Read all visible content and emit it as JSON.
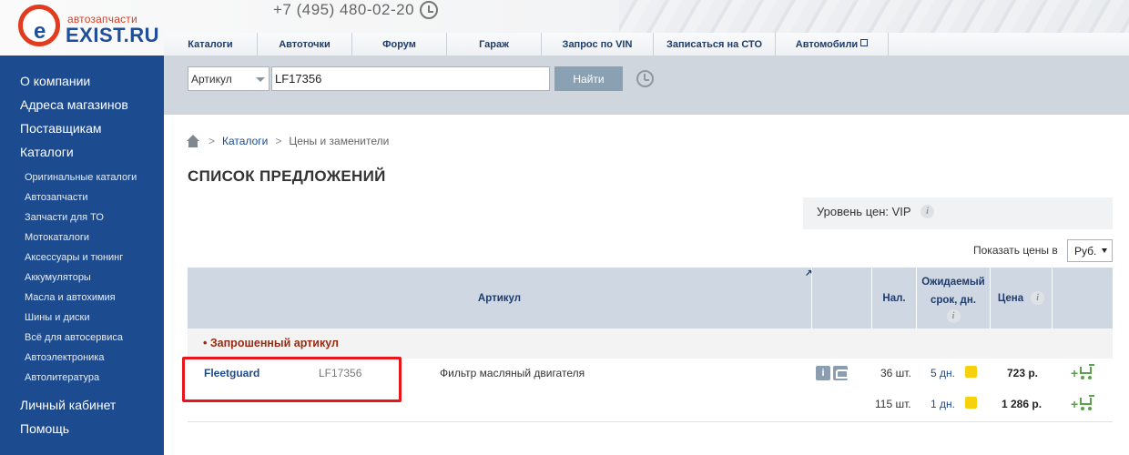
{
  "header": {
    "logo_small": "автозапчасти",
    "logo_big": "EXIST.RU",
    "logo_letter": "e",
    "phone": "+7 (495) 480-02-20",
    "nav": [
      {
        "label": "Каталоги"
      },
      {
        "label": "Автоточки"
      },
      {
        "label": "Форум"
      },
      {
        "label": "Гараж"
      },
      {
        "label": "Запрос по VIN"
      },
      {
        "label": "Записаться на СТО"
      },
      {
        "label": "Автомобили"
      }
    ]
  },
  "sidebar": {
    "main_top": [
      "О компании",
      "Адреса магазинов",
      "Поставщикам",
      "Каталоги"
    ],
    "sub": [
      "Оригинальные каталоги",
      "Автозапчасти",
      "Запчасти для ТО",
      "Мотокаталоги",
      "Аксессуары и тюнинг",
      "Аккумуляторы",
      "Масла и автохимия",
      "Шины и диски",
      "Всё для автосервиса",
      "Автоэлектроника",
      "Автолитература"
    ],
    "main_bottom": [
      "Личный кабинет",
      "Помощь"
    ]
  },
  "search": {
    "type": "Артикул",
    "value": "LF17356",
    "button": "Найти"
  },
  "breadcrumb": {
    "link": "Каталоги",
    "current": "Цены и заменители",
    "sep": ">"
  },
  "page_title": "СПИСОК ПРЕДЛОЖЕНИЙ",
  "price_level": {
    "text": "Уровень цен: VIP",
    "info": "i"
  },
  "show_prices": {
    "label": "Показать цены в",
    "currency": "Руб."
  },
  "table": {
    "headers": {
      "article": "Артикул",
      "stock": "Нал.",
      "delivery_line1": "Ожидаемый",
      "delivery_line2": "срок, дн.",
      "price": "Цена",
      "info": "i"
    },
    "group_label": "• Запрошенный артикул",
    "brand": "Fleetguard",
    "article": "LF17356",
    "description": "Фильтр масляный двигателя",
    "info_icon": "i",
    "offers": [
      {
        "stock": "36 шт.",
        "days": "5 дн.",
        "price": "723 р."
      },
      {
        "stock": "115 шт.",
        "days": "1 дн.",
        "price": "1 286 р."
      }
    ]
  },
  "colors": {
    "sidebar": "#1d4b8f",
    "brand_red": "#e33b1e",
    "highlight": "#e8151b",
    "status_yellow": "#f7d20c"
  }
}
